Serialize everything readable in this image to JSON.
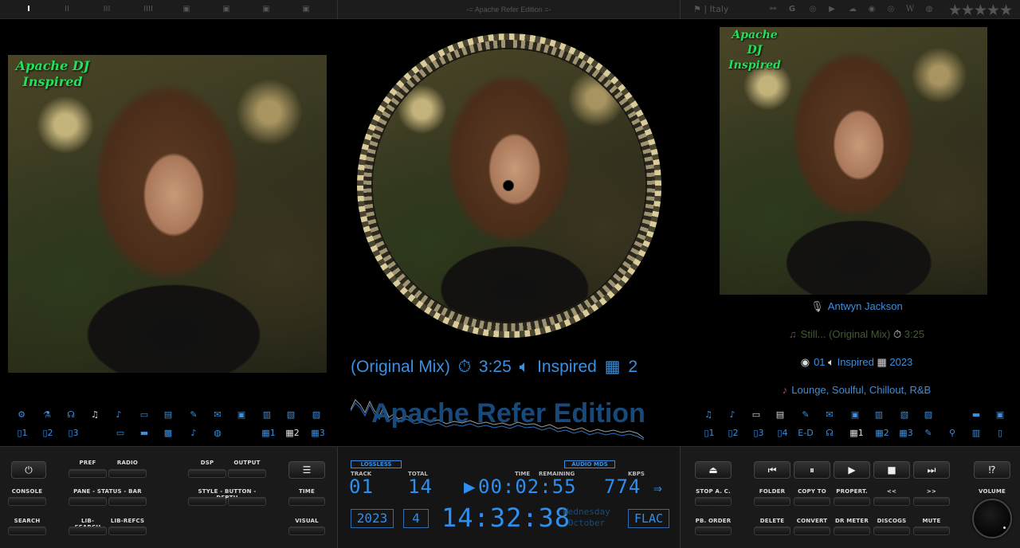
{
  "window_title": "-= Apache Refer Edition =-",
  "topbar": {
    "left_icons": [
      "I",
      "II",
      "III",
      "IIII",
      "▣",
      "▣",
      "▣",
      "▣"
    ],
    "country_label": "| Italy",
    "right_icons": [
      "link-icon",
      "google-icon",
      "lastfm-icon",
      "youtube-icon",
      "soundcloud-icon",
      "spotify-icon",
      "musicbrainz-icon",
      "wikipedia-icon",
      "podcast-icon"
    ],
    "rating_stars": "★★★★★"
  },
  "left_artwork": {
    "label_line1": "Apache DJ",
    "label_line2": "Inspired"
  },
  "right_artwork": {
    "label_line1": "Apache DJ",
    "label_line2": "Inspired"
  },
  "center_info": {
    "subtitle": "(Original Mix)",
    "duration": "3:25",
    "album": "Inspired",
    "disc": "2"
  },
  "watermark": "Apache Refer Edition",
  "right_meta": {
    "artist": "Antwyn Jackson",
    "title_line": "Still... (Original Mix)",
    "title_duration": "3:25",
    "track_no": "01",
    "album": "Inspired",
    "year": "2023",
    "genres": "Lounge, Soulful, Chillout, R&B"
  },
  "left_icons_row2": [
    "1",
    "2",
    "3",
    "1",
    "2",
    "3"
  ],
  "right_icons_row2": [
    "1",
    "2",
    "3",
    "4",
    "E-D",
    "1",
    "2",
    "3"
  ],
  "left_buttons": {
    "pref": "PREF",
    "radio": "RADIO",
    "dsp": "DSP",
    "output": "OUTPUT",
    "console": "CONSOLE",
    "pane_status_bar": "PANE - STATUS - BAR",
    "style_button_depth": "STYLE - BUTTON - DEPTH",
    "time": "TIME",
    "search": "SEARCH",
    "lib_search": "LIB-SEARCH",
    "lib_refcs": "LIB-REFCS",
    "visual": "VISUAL"
  },
  "lcd": {
    "lossless": "LOSSLESS",
    "audio_mds": "AUDIO MDS",
    "track_label": "TRACK",
    "total_label": "TOTAL",
    "time_label": "TIME",
    "remaining_label": "REMAINING",
    "kbps_label": "KBPS",
    "track": "01",
    "total": "14",
    "time": "00:02:55",
    "kbps": "774",
    "year": "2023",
    "month": "4",
    "clock": "14:32:38",
    "weekday": "Wednesday",
    "month_name": "October",
    "format": "FLAC"
  },
  "right_buttons": {
    "stop_ac": "STOP A. C.",
    "folder": "FOLDER",
    "copy_to": "COPY TO",
    "propert": "PROPERT.",
    "prev": "<<",
    "next": ">>",
    "volume": "VOLUME",
    "pb_order": "PB. ORDER",
    "delete": "DELETE",
    "convert": "CONVERT",
    "dr_meter": "DR METER",
    "discogs": "DISCOGS",
    "mute": "MUTE",
    "help": "⁉"
  }
}
